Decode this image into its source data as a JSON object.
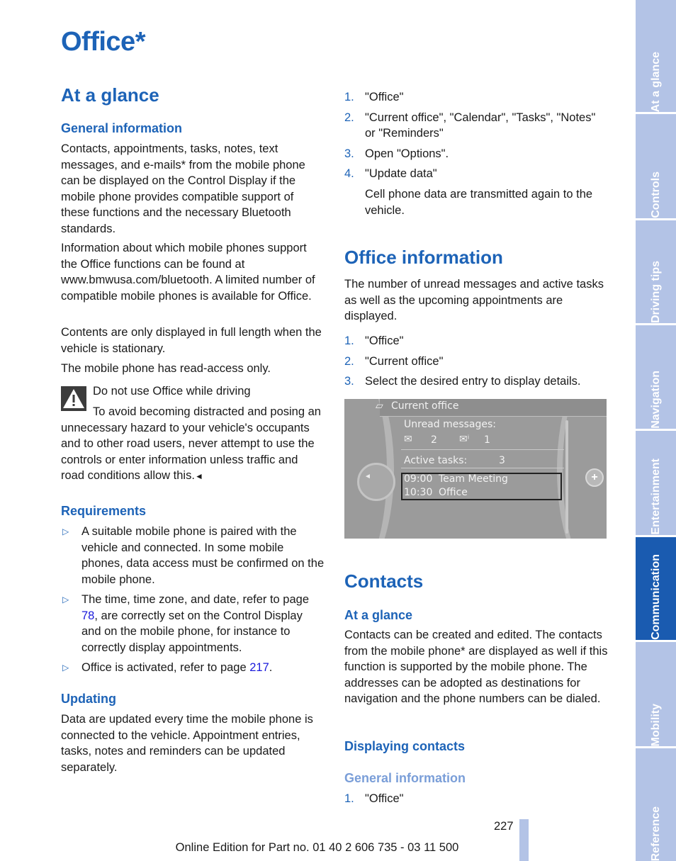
{
  "page": {
    "title": "Office*",
    "page_number": "227",
    "footer": "Online Edition for Part no. 01 40 2 606 735 - 03 11 500"
  },
  "sidebar": {
    "tabs": [
      {
        "label": "At a glance",
        "active": false
      },
      {
        "label": "Controls",
        "active": false
      },
      {
        "label": "Driving tips",
        "active": false
      },
      {
        "label": "Navigation",
        "active": false
      },
      {
        "label": "Entertainment",
        "active": false
      },
      {
        "label": "Communication",
        "active": true
      },
      {
        "label": "Mobility",
        "active": false
      },
      {
        "label": "Reference",
        "active": false
      }
    ]
  },
  "left": {
    "at_a_glance": {
      "heading": "At a glance",
      "general": {
        "heading": "General information",
        "paragraphs": [
          "Contacts, appointments, tasks, notes, text messages, and e-mails* from the mobile phone can be displayed on the Control Display if the mobile phone provides compatible support of these functions and the necessary Bluetooth standards.",
          "Information about which mobile phones support the Office functions can be found at www.bmwusa.com/bluetooth. A limited number of compatible mobile phones is available for Office.",
          "Contents are only displayed in full length when the vehicle is stationary.",
          "The mobile phone has read-access only."
        ]
      },
      "warning": {
        "icon": "warning-triangle-icon",
        "title": "Do not use Office while driving",
        "body": "To avoid becoming distracted and posing an unnecessary hazard to your vehicle's occupants and to other road users, never attempt to use the controls or enter information unless traffic and road conditions allow this.",
        "end_mark": "◄"
      }
    },
    "requirements": {
      "heading": "Requirements",
      "items": [
        {
          "text": "A suitable mobile phone is paired with the vehicle and connected. In some mobile phones, data access must be confirmed on the mobile phone."
        },
        {
          "pre": "The time, time zone, and date, refer to page ",
          "link": "78",
          "post": ", are correctly set on the Control Display and on the mobile phone, for instance to correctly display appointments."
        },
        {
          "pre": "Office is activated, refer to page ",
          "link": "217",
          "post": "."
        }
      ],
      "bullet": "▷"
    },
    "updating": {
      "heading": "Updating",
      "text": "Data are updated every time the mobile phone is connected to the vehicle. Appointment entries, tasks, notes and reminders can be updated separately."
    }
  },
  "right": {
    "update_steps": [
      {
        "num": "1.",
        "text": "\"Office\""
      },
      {
        "num": "2.",
        "text": "\"Current office\", \"Calendar\", \"Tasks\", \"Notes\" or \"Reminders\""
      },
      {
        "num": "3.",
        "text": "Open \"Options\"."
      },
      {
        "num": "4.",
        "text": "\"Update data\""
      }
    ],
    "update_note": "Cell phone data are transmitted again to the vehicle.",
    "office_info": {
      "heading": "Office information",
      "text": "The number of unread messages and active tasks as well as the upcoming appointments are displayed.",
      "steps": [
        {
          "num": "1.",
          "text": "\"Office\""
        },
        {
          "num": "2.",
          "text": "\"Current office\""
        },
        {
          "num": "3.",
          "text": "Select the desired entry to display details."
        }
      ]
    },
    "screen": {
      "title": "Current office",
      "unread_label": "Unread messages:",
      "unread_mail": "2",
      "unread_info": "1",
      "tasks_label": "Active tasks:",
      "tasks_count": "3",
      "appointments": [
        {
          "time": "09:00",
          "title": "Team Meeting"
        },
        {
          "time": "10:30",
          "title": "Office"
        }
      ]
    },
    "contacts": {
      "heading": "Contacts",
      "at_a_glance": {
        "heading": "At a glance",
        "text": "Contacts can be created and edited. The contacts from the mobile phone* are displayed as well if this function is supported by the mobile phone. The addresses can be adopted as destinations for navigation and the phone numbers can be dialed."
      },
      "displaying": {
        "heading": "Displaying contacts",
        "general_heading": "General information",
        "steps": [
          {
            "num": "1.",
            "text": "\"Office\""
          }
        ]
      }
    }
  },
  "colors": {
    "heading_blue": "#1d63b7",
    "subheading_light_blue": "#7a9ed8",
    "tab_inactive": "#b3c3e6",
    "tab_active": "#1a5bb0",
    "link": "#1a1adb"
  }
}
